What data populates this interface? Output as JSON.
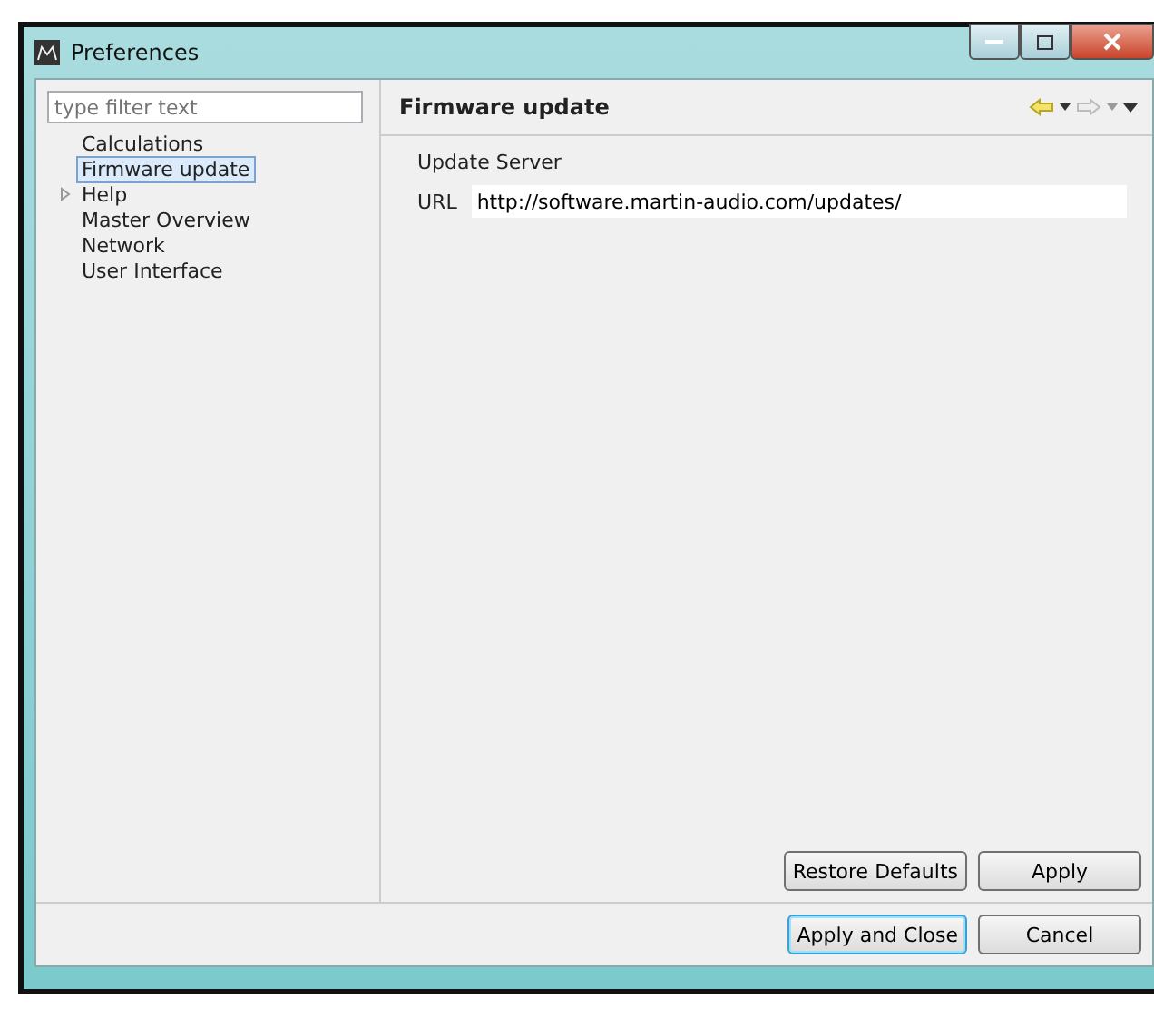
{
  "window": {
    "title": "Preferences"
  },
  "filter": {
    "placeholder": "type filter text"
  },
  "tree": [
    {
      "label": "Calculations",
      "selected": false,
      "expandable": false
    },
    {
      "label": "Firmware update",
      "selected": true,
      "expandable": false
    },
    {
      "label": "Help",
      "selected": false,
      "expandable": true
    },
    {
      "label": "Master Overview",
      "selected": false,
      "expandable": false
    },
    {
      "label": "Network",
      "selected": false,
      "expandable": false
    },
    {
      "label": "User Interface",
      "selected": false,
      "expandable": false
    }
  ],
  "page": {
    "title": "Firmware update",
    "group": "Update Server",
    "field_label": "URL",
    "field_value": "http://software.martin-audio.com/updates/"
  },
  "page_buttons": [
    "Restore Defaults",
    "Apply"
  ],
  "dialog_buttons": [
    {
      "label": "Apply and Close",
      "default": true
    },
    {
      "label": "Cancel",
      "default": false
    }
  ]
}
